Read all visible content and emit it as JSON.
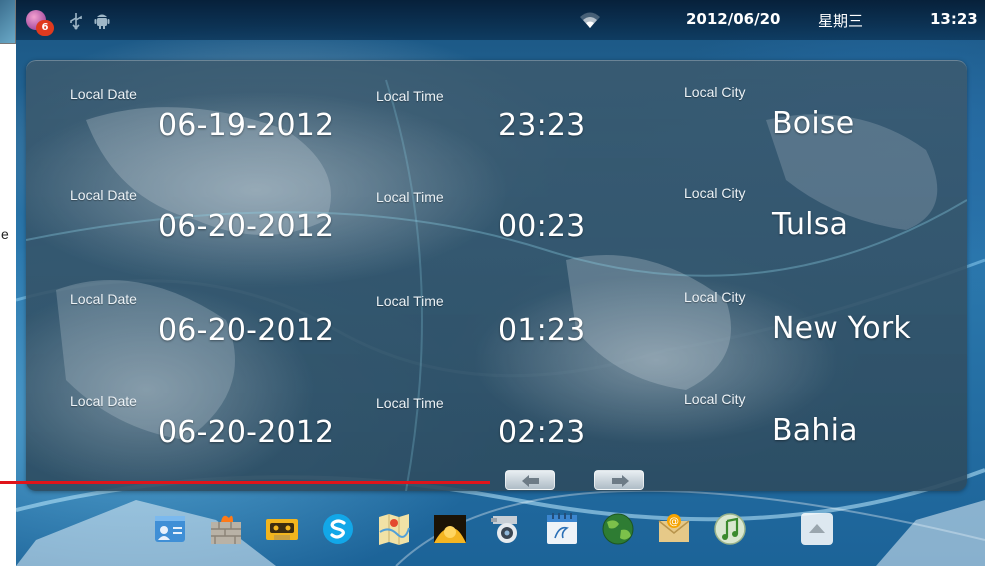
{
  "status_bar": {
    "notification_count": "6",
    "date": "2012/06/20",
    "weekday": "星期三",
    "clock": "13:23",
    "icons": [
      "notification-icon",
      "usb-icon",
      "android-debug-icon",
      "wifi-icon"
    ]
  },
  "annotation": {
    "margin_letter": "e"
  },
  "world_clock": {
    "label_date": "Local Date",
    "label_time": "Local Time",
    "label_city": "Local City",
    "rows": [
      {
        "date": "06-19-2012",
        "time": "23:23",
        "city": "Boise"
      },
      {
        "date": "06-20-2012",
        "time": "00:23",
        "city": "Tulsa"
      },
      {
        "date": "06-20-2012",
        "time": "01:23",
        "city": "New York"
      },
      {
        "date": "06-20-2012",
        "time": "02:23",
        "city": "Bahia"
      }
    ],
    "nav": [
      "prev-arrow-icon",
      "next-arrow-icon"
    ]
  },
  "dock": {
    "icons": [
      "contacts-icon",
      "firewall-icon",
      "cassette-icon",
      "skype-icon",
      "maps-icon",
      "gallery-icon",
      "webcam-icon",
      "calendar-notes-icon",
      "browser-globe-icon",
      "email-icon",
      "music-icon",
      "app-drawer-icon"
    ]
  },
  "colors": {
    "annotation_line": "#e0141a",
    "status_bar": "#0a2f52",
    "badge": "#e03a1e"
  }
}
